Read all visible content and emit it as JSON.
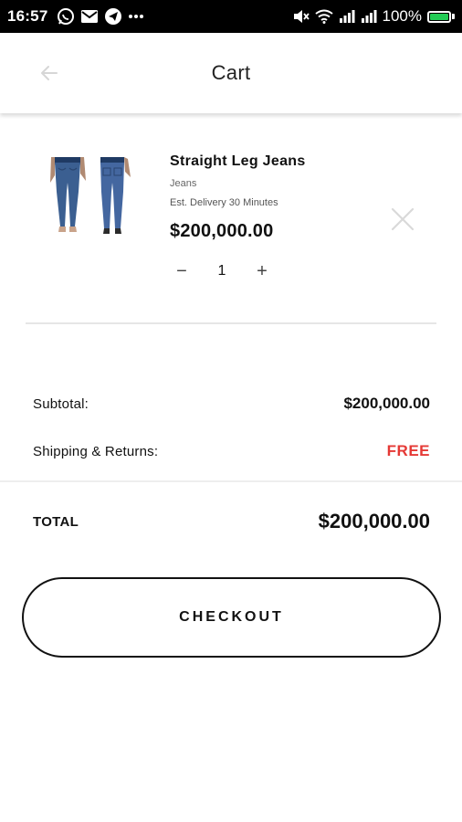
{
  "status_bar": {
    "time": "16:57",
    "battery": "100%",
    "left_icons": [
      "whatsapp-icon",
      "gmail-icon",
      "telegram-icon",
      "more-dots-icon"
    ],
    "right_icons": [
      "mute-icon",
      "wifi-icon",
      "signal-icon",
      "signal-icon-2",
      "battery-icon"
    ],
    "battery_color": "#22cc55"
  },
  "header": {
    "title": "Cart",
    "back_icon": "arrow-left-icon"
  },
  "cart_item": {
    "name": "Straight Leg Jeans",
    "category": "Jeans",
    "delivery": "Est. Delivery 30 Minutes",
    "price": "$200,000.00",
    "quantity": "1",
    "minus_label": "−",
    "plus_label": "+",
    "remove_icon": "close-icon",
    "image": "jeans-product-image"
  },
  "summary": {
    "subtotal_label": "Subtotal:",
    "subtotal_value": "$200,000.00",
    "shipping_label": "Shipping & Returns:",
    "shipping_value": "FREE",
    "total_label": "TOTAL",
    "total_value": "$200,000.00"
  },
  "checkout": {
    "label": "CHECKOUT"
  },
  "colors": {
    "free": "#e53935",
    "text": "#111111",
    "status_bar": "#000000"
  }
}
